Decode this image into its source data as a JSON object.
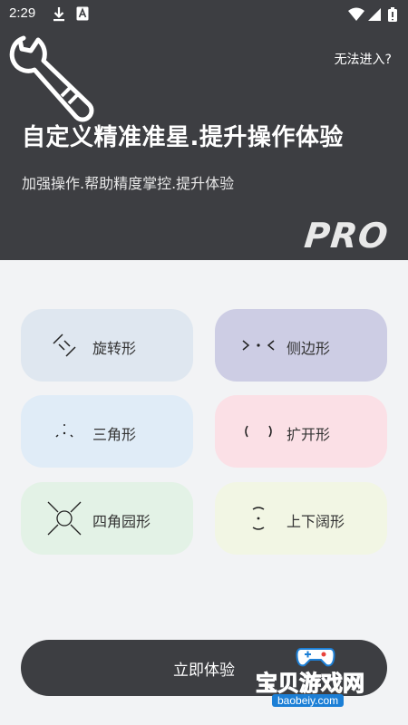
{
  "status_bar": {
    "time": "2:29",
    "icons": [
      "download-icon",
      "a-icon",
      "wifi-icon",
      "signal-icon",
      "battery-icon"
    ]
  },
  "header": {
    "cannot_enter": "无法进入?",
    "title": "自定义精准准星.提升操作体验",
    "subtitle": "加强操作.帮助精度掌控.提升体验",
    "pro_label": "PRO",
    "background": "#3d3e42"
  },
  "crosshair_options": [
    {
      "label": "旋转形",
      "icon": "rotate-crosshair-icon",
      "color": "#dfe7f0"
    },
    {
      "label": "侧边形",
      "icon": "side-crosshair-icon",
      "color": "#cdcde4"
    },
    {
      "label": "三角形",
      "icon": "triangle-crosshair-icon",
      "color": "#e0ecf7"
    },
    {
      "label": "扩开形",
      "icon": "expand-crosshair-icon",
      "color": "#fbe0e6"
    },
    {
      "label": "四角园形",
      "icon": "four-corner-circle-crosshair-icon",
      "color": "#e3f2e6"
    },
    {
      "label": "上下阔形",
      "icon": "up-down-wide-crosshair-icon",
      "color": "#f2f6e4"
    }
  ],
  "try_button": {
    "label": "立即体验"
  },
  "watermark": {
    "text": "宝贝游戏网",
    "url": "baobeiy.com"
  }
}
